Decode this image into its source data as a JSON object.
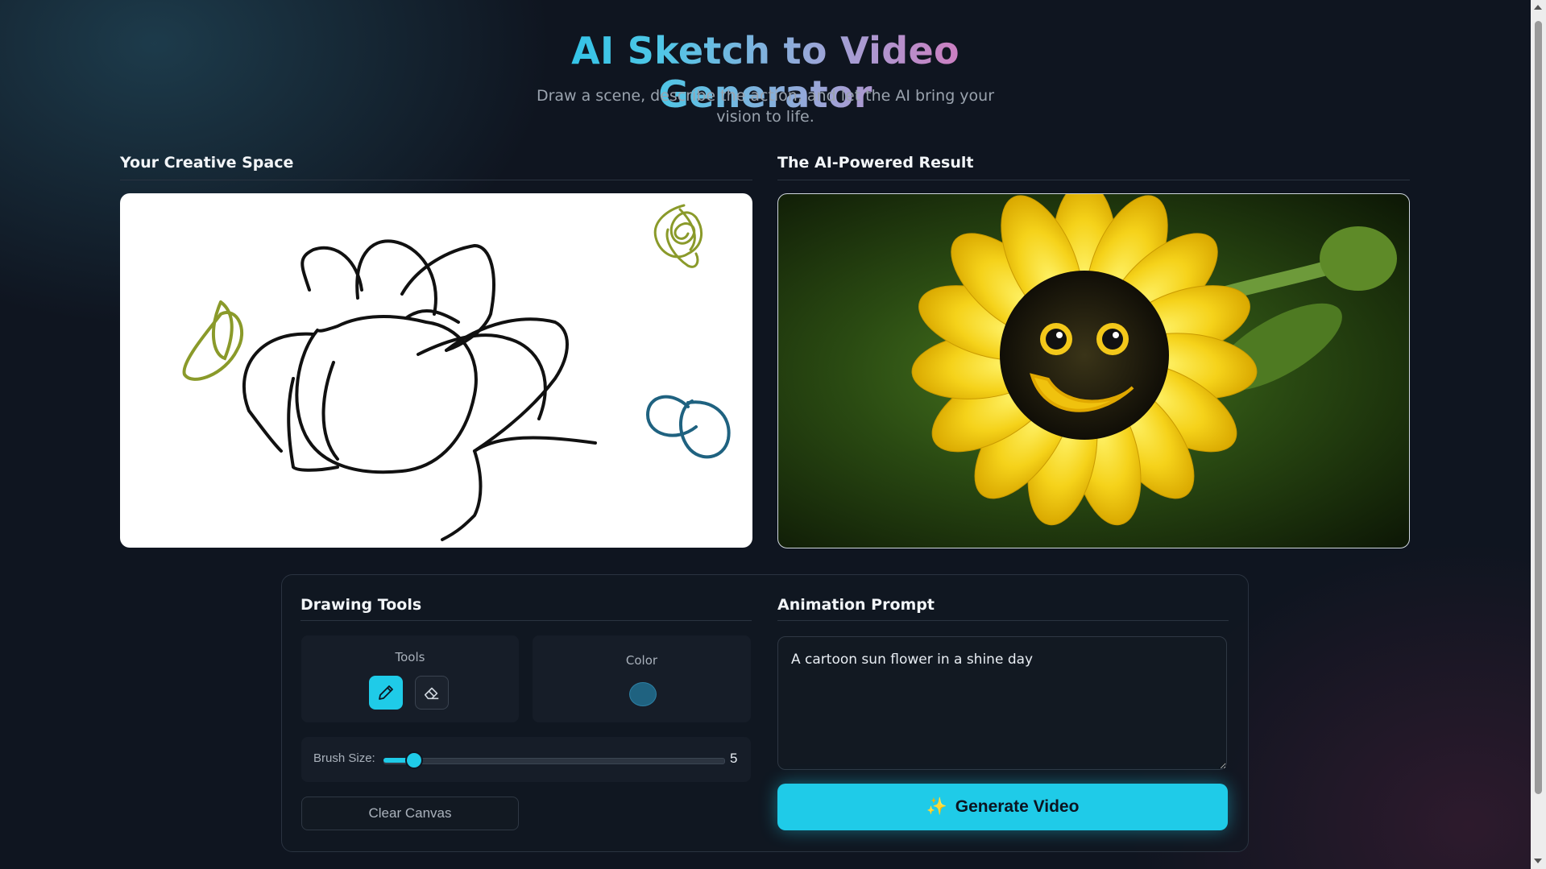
{
  "header": {
    "title": "AI Sketch to Video Generator",
    "subtitle": "Draw a scene, describe the action, and let the AI bring your vision to life."
  },
  "creative_space": {
    "title": "Your Creative Space"
  },
  "result": {
    "title": "The AI-Powered Result"
  },
  "drawing_tools": {
    "title": "Drawing Tools",
    "tools_label": "Tools",
    "tools": [
      {
        "name": "pencil-icon",
        "active": true
      },
      {
        "name": "eraser-icon",
        "active": false
      }
    ],
    "color_label": "Color",
    "selected_color": "#1f6280",
    "brush_size_label": "Brush Size:",
    "brush_size_value": "5",
    "brush_size_fraction": 0.09,
    "clear_label": "Clear Canvas"
  },
  "animation": {
    "title": "Animation Prompt",
    "prompt_value": "A cartoon sun flower in a shine day",
    "generate_label": "Generate Video",
    "generate_icon": "sparkles-icon"
  },
  "colors": {
    "accent": "#1fcbe8",
    "background": "#0f1520",
    "sketch_green": "#8a9a2a",
    "sketch_blue": "#1f6280"
  }
}
